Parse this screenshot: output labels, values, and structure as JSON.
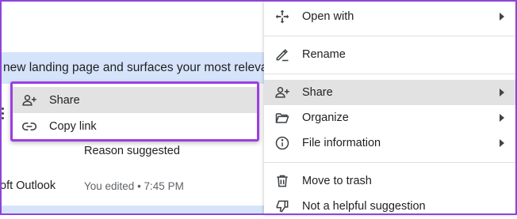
{
  "background": {
    "banner_text": "new landing page and surfaces your most relevant fi",
    "reason_text": "Reason suggested",
    "file_name_fragment": "oft Outlook",
    "edited_text": "You edited • 7:45 PM"
  },
  "mini_menu": {
    "items": [
      {
        "label": "Share",
        "icon": "person-add-icon"
      },
      {
        "label": "Copy link",
        "icon": "link-icon"
      }
    ]
  },
  "main_menu": {
    "items": [
      {
        "label": "Open with",
        "icon": "move-arrows-icon",
        "submenu": true
      },
      {
        "label": "Rename",
        "icon": "pencil-icon",
        "submenu": false
      },
      {
        "label": "Share",
        "icon": "person-add-icon",
        "submenu": true
      },
      {
        "label": "Organize",
        "icon": "folder-open-icon",
        "submenu": true
      },
      {
        "label": "File information",
        "icon": "info-icon",
        "submenu": true
      },
      {
        "label": "Move to trash",
        "icon": "trash-icon",
        "submenu": false
      },
      {
        "label": "Not a helpful suggestion",
        "icon": "thumbs-down-icon",
        "submenu": false
      }
    ]
  },
  "colors": {
    "highlight_border": "#9b3fe0",
    "hover_bg": "#e2e2e2",
    "banner_bg": "#d6e4fb"
  }
}
